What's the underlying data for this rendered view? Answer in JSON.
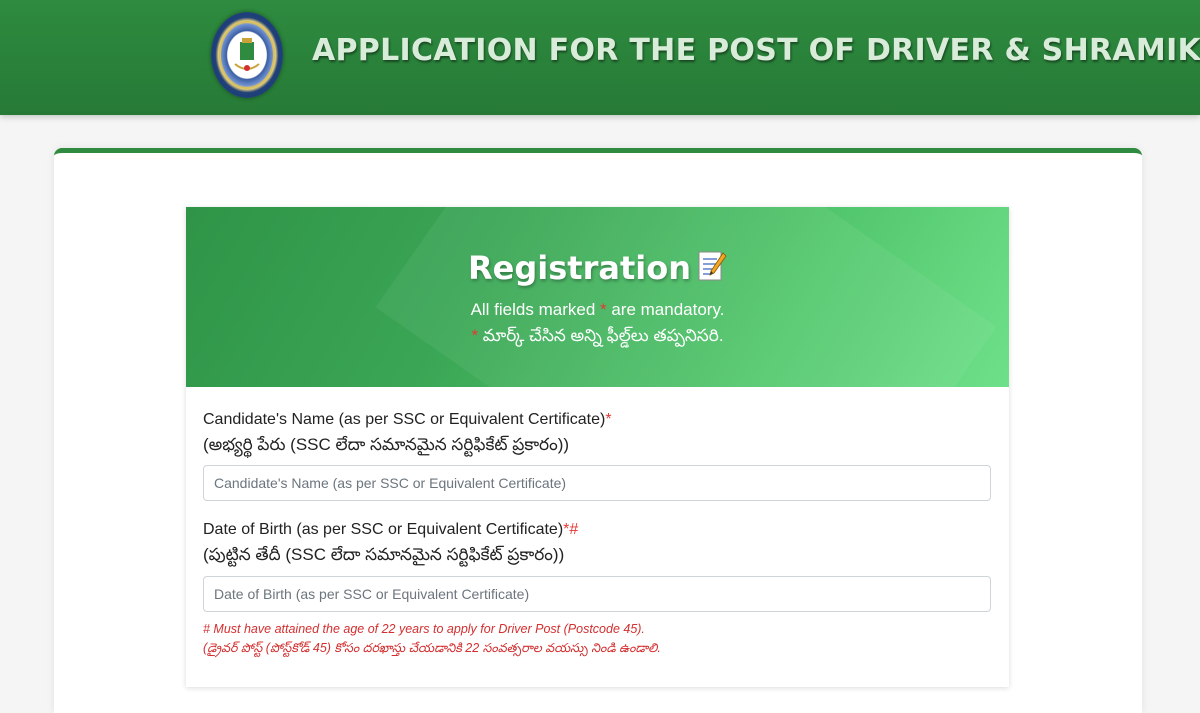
{
  "header": {
    "title": "APPLICATION FOR THE POST OF DRIVER & SHRAMIK",
    "logo_icon": "police-recruitment-board-emblem"
  },
  "registration": {
    "title": "Registration",
    "title_icon": "memo-icon",
    "mandatory_text_pre": "All fields marked ",
    "mandatory_star": "*",
    "mandatory_text_post": " are mandatory.",
    "mandatory_te_star": "*",
    "mandatory_te_text": " మార్క్ చేసిన అన్ని ఫీల్డ్‌లు తప్పనిసరి."
  },
  "fields": {
    "name": {
      "label": "Candidate's Name (as per SSC or Equivalent Certificate)",
      "marker": "*",
      "label_te": "(అభ్యర్థి పేరు (SSC లేదా సమానమైన సర్టిఫికేట్ ప్రకారం))",
      "placeholder": "Candidate's Name (as per SSC or Equivalent Certificate)",
      "value": ""
    },
    "dob": {
      "label": "Date of Birth (as per SSC or Equivalent Certificate)",
      "marker": "*#",
      "label_te": "(పుట్టిన తేదీ (SSC లేదా సమానమైన సర్టిఫికేట్ ప్రకారం))",
      "placeholder": "Date of Birth (as per SSC or Equivalent Certificate)",
      "value": "",
      "note": "# Must have attained the age of 22 years to apply for Driver Post (Postcode 45).",
      "note_te": "(డ్రైవర్ పోస్ట్ (పోస్ట్‌కోడ్ 45) కోసం దరఖాస్తు చేయడానికి 22 సంవత్సరాల వయస్సు నిండి ఉండాలి."
    }
  },
  "colors": {
    "header_green": "#2e8b3f",
    "banner_green_start": "#2f9447",
    "banner_green_end": "#6ee08a",
    "required_red": "#e53935"
  }
}
